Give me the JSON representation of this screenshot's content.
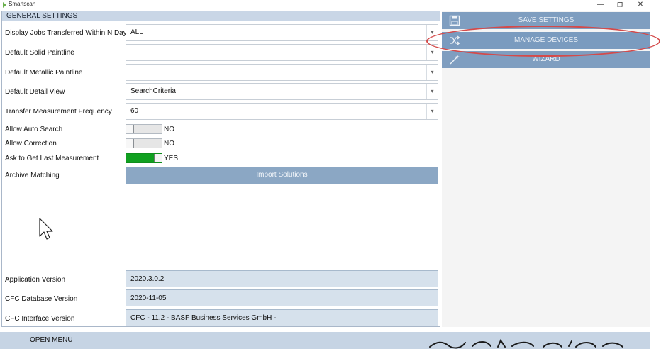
{
  "window": {
    "title": "Smartscan",
    "min_glyph": "—",
    "max_glyph": "❐",
    "close_glyph": "✕"
  },
  "panel": {
    "header": "GENERAL SETTINGS",
    "rows": {
      "display_jobs": {
        "label": "Display Jobs Transferred Within N Days",
        "value": "ALL"
      },
      "solid_paintline": {
        "label": "Default Solid Paintline",
        "value": ""
      },
      "metallic_paintline": {
        "label": "Default Metallic Paintline",
        "value": ""
      },
      "detail_view": {
        "label": "Default Detail View",
        "value": "SearchCriteria"
      },
      "transfer_freq": {
        "label": "Transfer Measurement Frequency",
        "value": "60"
      },
      "auto_search": {
        "label": "Allow Auto Search",
        "state": "NO"
      },
      "correction": {
        "label": "Allow Correction",
        "state": "NO"
      },
      "last_measurement": {
        "label": "Ask to Get Last Measurement",
        "state": "YES"
      },
      "archive_matching": {
        "label": "Archive Matching",
        "button": "Import Solutions"
      }
    },
    "versions": {
      "app": {
        "label": "Application Version",
        "value": "2020.3.0.2"
      },
      "db": {
        "label": "CFC Database Version",
        "value": "2020-11-05"
      },
      "iface": {
        "label": "CFC Interface Version",
        "value": "CFC - 11.2 - BASF Business Services GmbH -"
      }
    }
  },
  "sidebar": {
    "save": "SAVE SETTINGS",
    "manage": "MANAGE DEVICES",
    "wizard": "WIZARD"
  },
  "bottom": {
    "open_menu": "OPEN MENU"
  },
  "colors": {
    "accent": "#7f9ec0",
    "toggle_on": "#10a020",
    "highlight": "#d44a4a"
  }
}
